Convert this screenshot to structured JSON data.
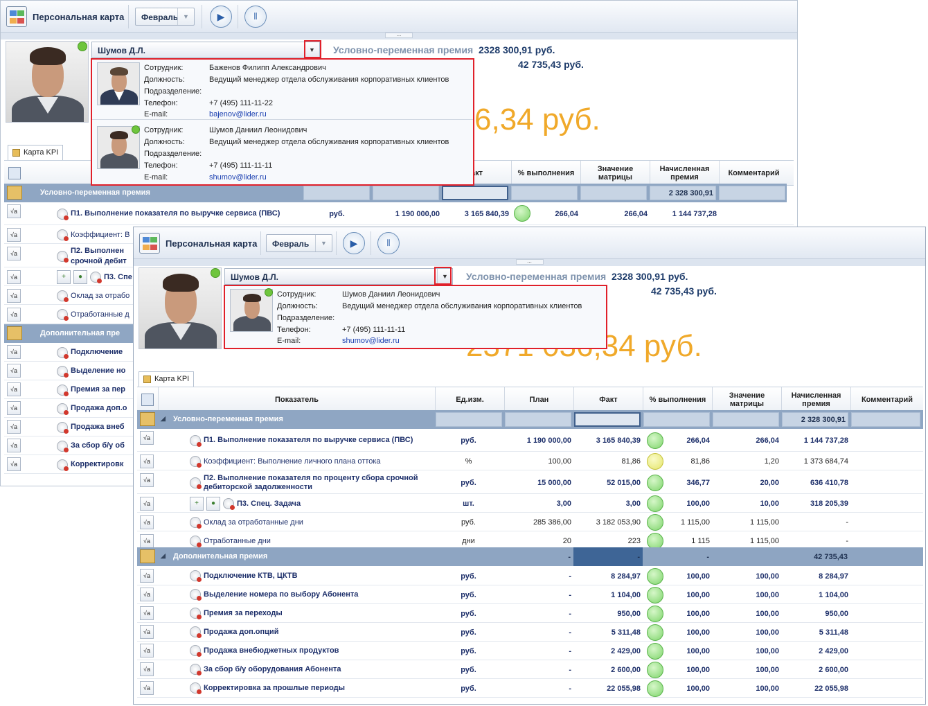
{
  "app": {
    "title": "Персональная карта",
    "month": "Февраль"
  },
  "employee": {
    "selected": "Шумов Д.Л."
  },
  "bonus": {
    "label": "Условно-переменная премия",
    "value1": "2328 300,91 руб.",
    "value2": "42 735,43 руб.",
    "total_w2": "2371 036,34 руб.",
    "total_w1_partial": "6,34 руб."
  },
  "popup_labels": {
    "employee": "Сотрудник:",
    "position": "Должность:",
    "department": "Подразделение:",
    "phone": "Телефон:",
    "email": "E-mail:"
  },
  "employees": [
    {
      "name": "Баженов Филипп Александрович",
      "position": "Ведущий менеджер отдела обслуживания корпоративных клиентов",
      "department": "",
      "phone": "+7 (495) 111-11-22",
      "email": "bajenov@lider.ru"
    },
    {
      "name": "Шумов Даниил Леонидович",
      "position": "Ведущий менеджер отдела обслуживания корпоративных клиентов",
      "department": "",
      "phone": "+7 (495) 111-11-11",
      "email": "shumov@lider.ru"
    }
  ],
  "tab": "Карта KPI",
  "columns": [
    "Показатель",
    "Ед.изм.",
    "План",
    "Факт",
    "% выполнения",
    "Значение матрицы",
    "Начисленная премия",
    "Комментарий"
  ],
  "col1_partial": "акт",
  "group1": {
    "name": "Условно-переменная премия",
    "total": "2 328 300,91"
  },
  "group2": {
    "name": "Дополнительная премия",
    "plan": "-",
    "fact": "-",
    "pct": "-",
    "total": "42 735,43"
  },
  "rows1": [
    {
      "name": "П1. Выполнение показателя по выручке сервиса (ПВС)",
      "unit": "руб.",
      "plan": "1 190 000,00",
      "fact": "3 165 840,39",
      "ind": "green",
      "pct": "266,04",
      "matrix": "266,04",
      "bonus": "1 144 737,28",
      "bold": true
    },
    {
      "name": "Коэффициент: Выполнение личного плана оттока",
      "unit": "%",
      "plan": "100,00",
      "fact": "81,86",
      "ind": "yellow",
      "pct": "81,86",
      "matrix": "1,20",
      "bonus": "1 373 684,74",
      "bold": false
    },
    {
      "name": "П2. Выполнение показателя по проценту сбора срочной дебиторской задолженности",
      "unit": "руб.",
      "plan": "15 000,00",
      "fact": "52 015,00",
      "ind": "green",
      "pct": "346,77",
      "matrix": "20,00",
      "bonus": "636 410,78",
      "bold": true
    },
    {
      "name": "П3. Спец. Задача",
      "unit": "шт.",
      "plan": "3,00",
      "fact": "3,00",
      "ind": "green",
      "pct": "100,00",
      "matrix": "10,00",
      "bonus": "318 205,39",
      "bold": true
    },
    {
      "name": "Оклад за отработанные дни",
      "unit": "руб.",
      "plan": "285 386,00",
      "fact": "3 182 053,90",
      "ind": "green",
      "pct": "1 115,00",
      "matrix": "1 115,00",
      "bonus": "-",
      "bold": false
    },
    {
      "name": "Отработанные дни",
      "unit": "дни",
      "plan": "20",
      "fact": "223",
      "ind": "green",
      "pct": "1 115",
      "matrix": "1 115,00",
      "bonus": "-",
      "bold": false
    }
  ],
  "rows2": [
    {
      "name": "Подключение КТВ, ЦКТВ",
      "unit": "руб.",
      "plan": "-",
      "fact": "8 284,97",
      "pct": "100,00",
      "matrix": "100,00",
      "bonus": "8 284,97"
    },
    {
      "name": "Выделение номера по выбору Абонента",
      "unit": "руб.",
      "plan": "-",
      "fact": "1 104,00",
      "pct": "100,00",
      "matrix": "100,00",
      "bonus": "1 104,00"
    },
    {
      "name": "Премия за переходы",
      "unit": "руб.",
      "plan": "-",
      "fact": "950,00",
      "pct": "100,00",
      "matrix": "100,00",
      "bonus": "950,00"
    },
    {
      "name": "Продажа доп.опций",
      "unit": "руб.",
      "plan": "-",
      "fact": "5 311,48",
      "pct": "100,00",
      "matrix": "100,00",
      "bonus": "5 311,48"
    },
    {
      "name": "Продажа внебюджетных продуктов",
      "unit": "руб.",
      "plan": "-",
      "fact": "2 429,00",
      "pct": "100,00",
      "matrix": "100,00",
      "bonus": "2 429,00"
    },
    {
      "name": "За сбор б/у оборудования Абонента",
      "unit": "руб.",
      "plan": "-",
      "fact": "2 600,00",
      "pct": "100,00",
      "matrix": "100,00",
      "bonus": "2 600,00"
    },
    {
      "name": "Корректировка за прошлые периоды",
      "unit": "руб.",
      "plan": "-",
      "fact": "22 055,98",
      "pct": "100,00",
      "matrix": "100,00",
      "bonus": "22 055,98"
    }
  ],
  "w1_row_names": [
    "П1. Выполнение показателя по выручке сервиса (ПВС)",
    "Коэффициент: В",
    "П2. Выполнен",
    "срочной дебит",
    "П3. Спе",
    "Оклад за отрабо",
    "Отработанные д",
    "Дополнительная пре",
    "Подключение",
    "Выделение но",
    "Премия за пер",
    "Продажа доп.о",
    "Продажа внеб",
    "За сбор б/у об",
    "Корректировк"
  ]
}
